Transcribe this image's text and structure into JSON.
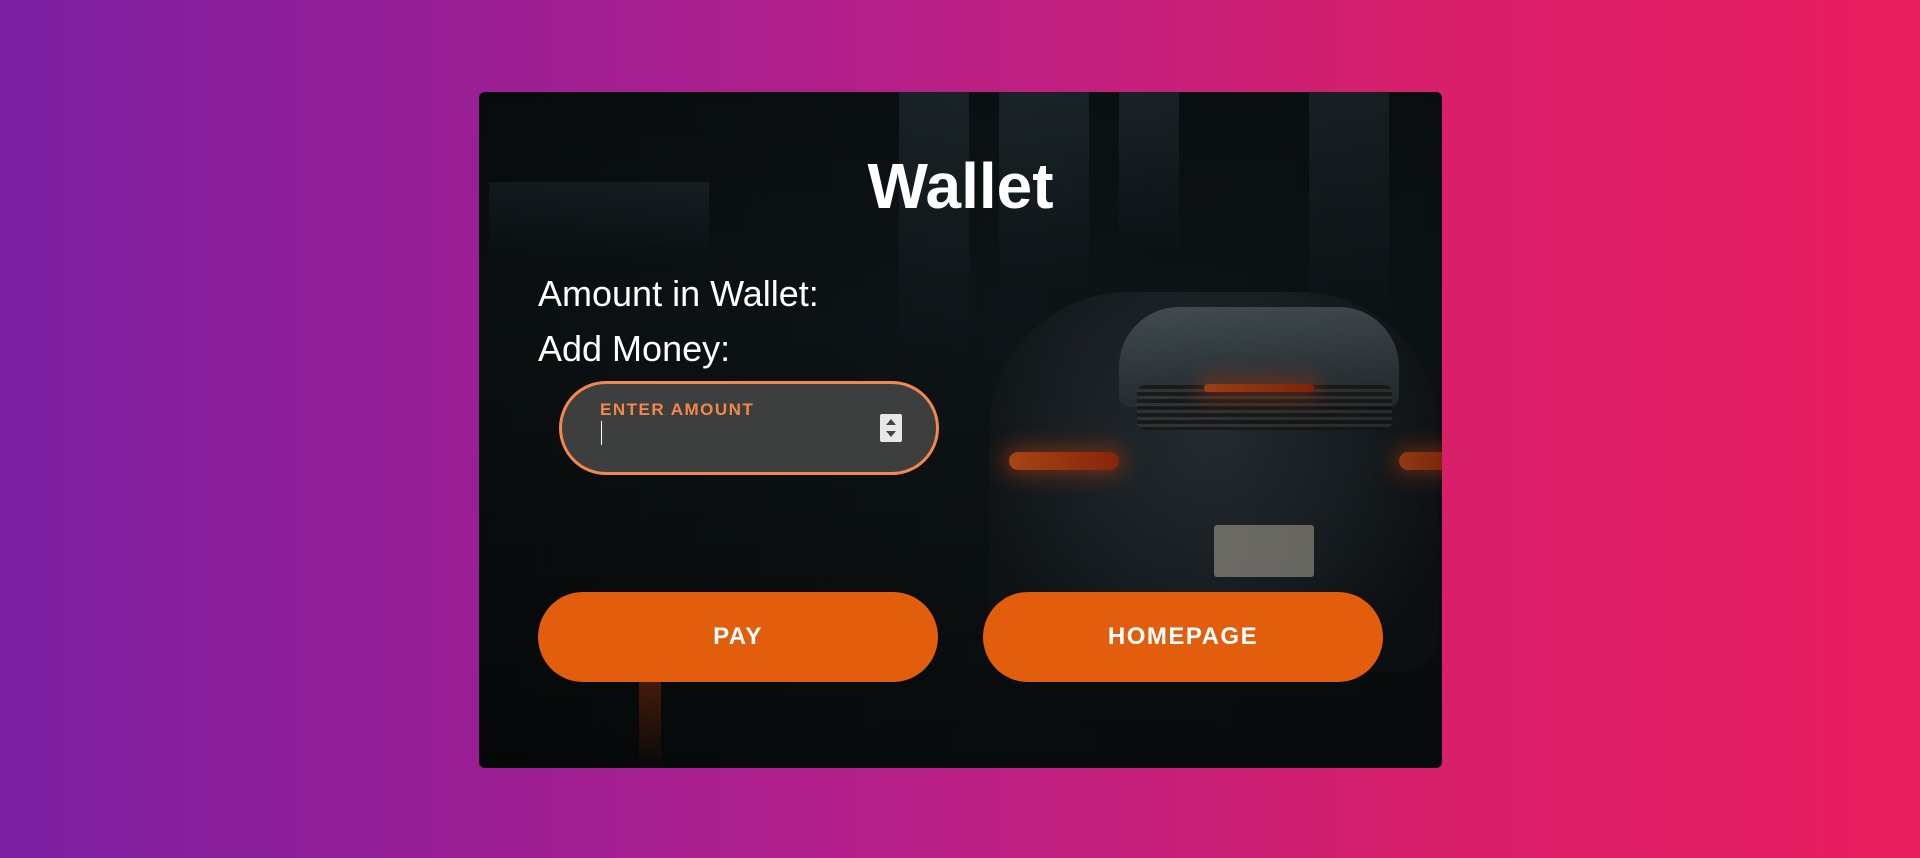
{
  "wallet": {
    "title": "Wallet",
    "amount_label": "Amount in Wallet:",
    "add_money_label": "Add Money:",
    "amount_field": {
      "label": "ENTER AMOUNT",
      "value": "",
      "type": "number"
    },
    "pay_button": "PAY",
    "homepage_button": "HOMEPAGE"
  },
  "colors": {
    "accent": "#e25e0d",
    "field_border": "#f3884a",
    "background_start": "#7b1fa2",
    "background_end": "#e91e5f"
  }
}
